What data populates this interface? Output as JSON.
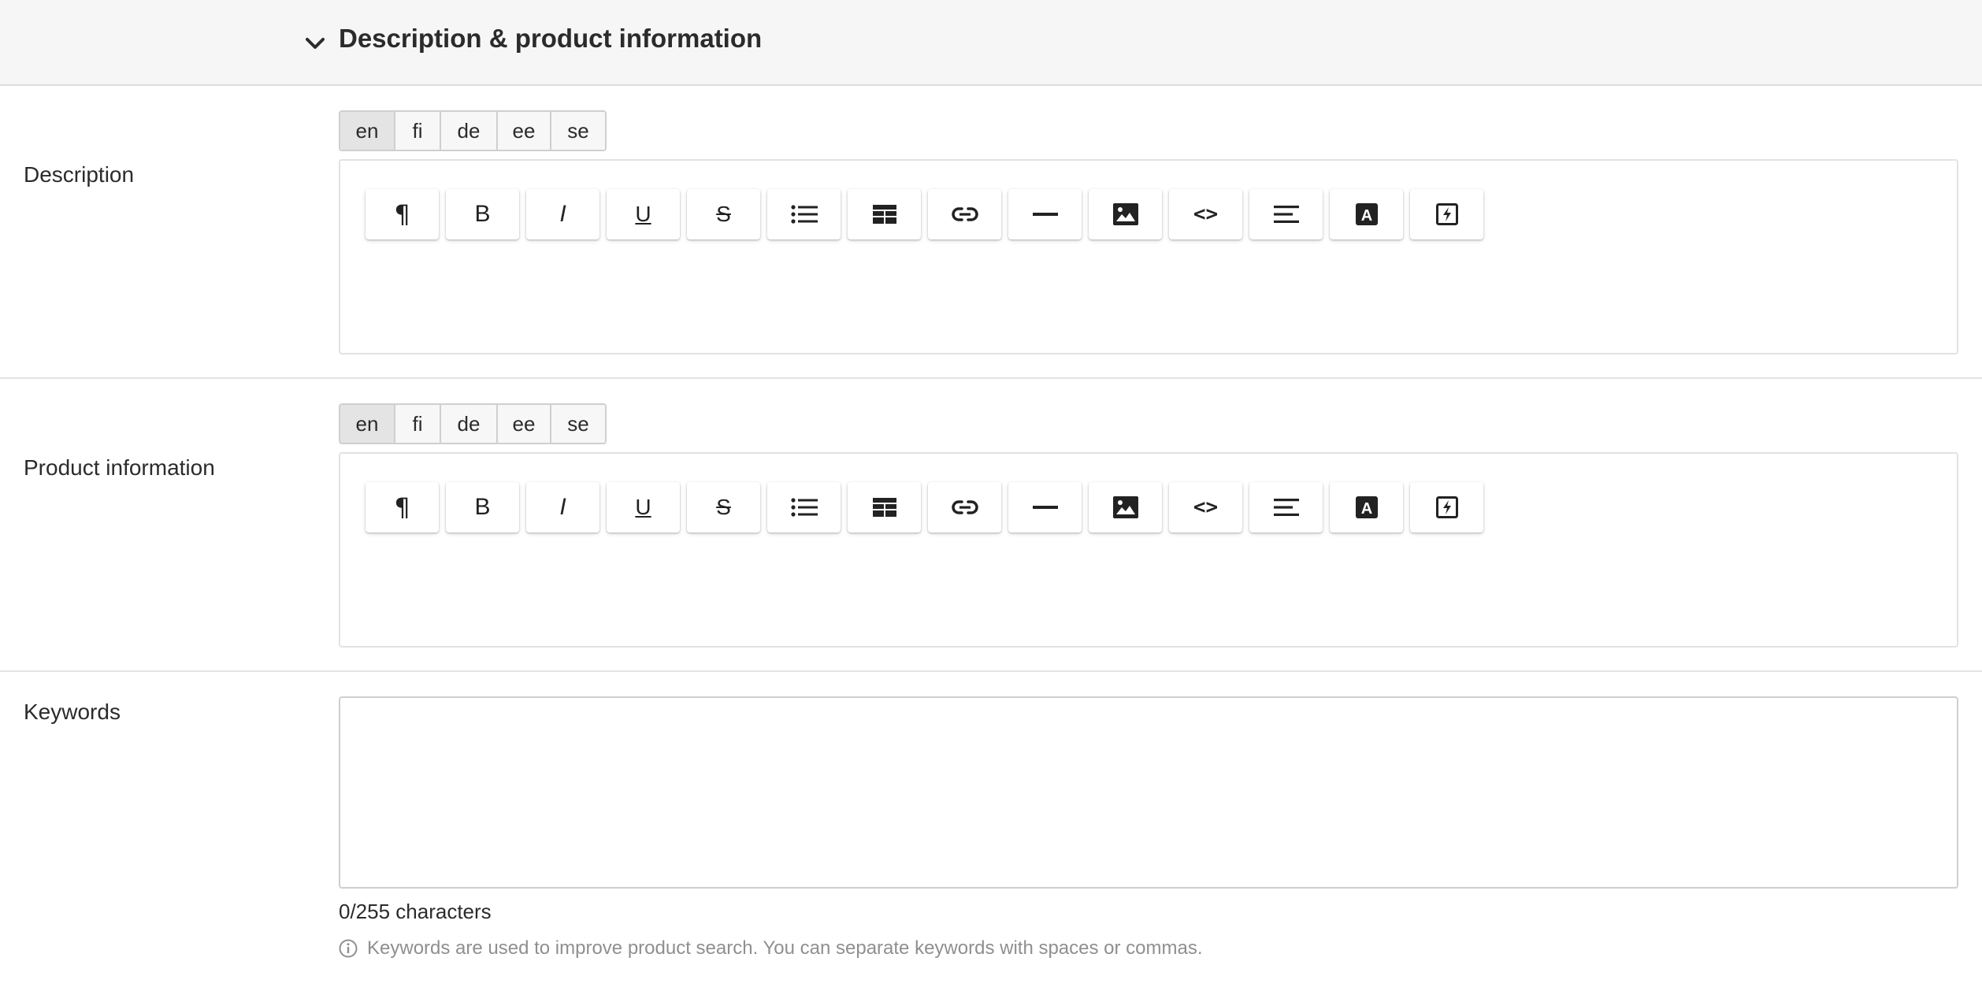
{
  "section": {
    "title": "Description & product information",
    "toggle_icon": "chevron-down-icon"
  },
  "languages": [
    "en",
    "fi",
    "de",
    "ee",
    "se"
  ],
  "active_language": "en",
  "description": {
    "label": "Description"
  },
  "product_info": {
    "label": "Product information"
  },
  "toolbar": {
    "buttons": [
      {
        "name": "paragraph",
        "glyph": "¶"
      },
      {
        "name": "bold",
        "glyph": "B"
      },
      {
        "name": "italic",
        "glyph": "I"
      },
      {
        "name": "underline",
        "glyph": "U"
      },
      {
        "name": "strikethrough",
        "glyph": "S"
      },
      {
        "name": "bulleted-list",
        "icon": "list-icon"
      },
      {
        "name": "table",
        "icon": "table-icon"
      },
      {
        "name": "link",
        "icon": "link-icon"
      },
      {
        "name": "horizontal-rule",
        "icon": "horizontal-rule-icon"
      },
      {
        "name": "image",
        "icon": "image-icon"
      },
      {
        "name": "code",
        "glyph": "<>"
      },
      {
        "name": "align",
        "icon": "align-left-icon"
      },
      {
        "name": "text-color",
        "glyph": "A"
      },
      {
        "name": "clear-format",
        "icon": "clear-format-icon"
      }
    ]
  },
  "keywords": {
    "label": "Keywords",
    "value": "",
    "char_count": "0/255 characters",
    "hint": "Keywords are used to improve product search. You can separate keywords with spaces or commas."
  }
}
